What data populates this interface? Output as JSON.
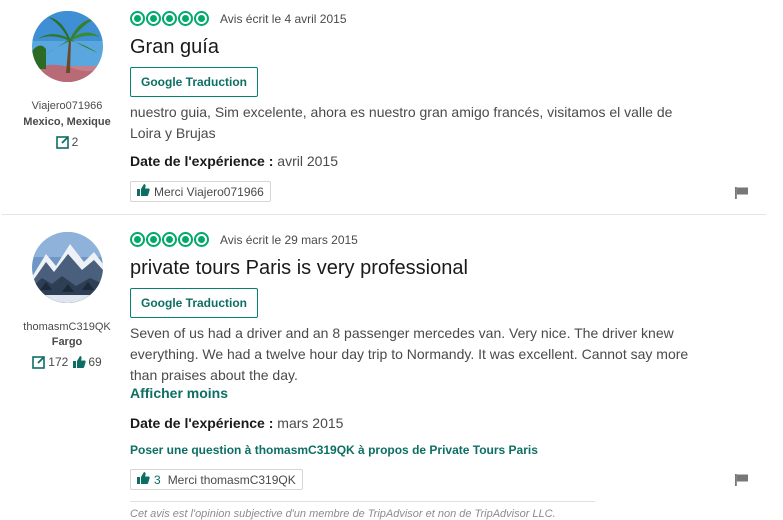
{
  "colors": {
    "accent": "#00aa6c",
    "link": "#0d6f63",
    "text": "#4a4a4a"
  },
  "reviews": [
    {
      "reviewer": {
        "username": "Viajero071966",
        "location": "Mexico, Mexique",
        "review_count": "2"
      },
      "rating": 5,
      "date": "Avis écrit le 4 avril 2015",
      "title": "Gran guía",
      "translate_label": "Google Traduction",
      "text": "nuestro guia, Sim excelente, ahora es nuestro gran amigo francés, visitamos el valle de Loira y Brujas",
      "experience_label": "Date de l'expérience :",
      "experience_value": "avril 2015",
      "thanks_label": "Merci Viajero071966"
    },
    {
      "reviewer": {
        "username": "thomasmC319QK",
        "location": "Fargo",
        "review_count": "172",
        "helpful_count": "69"
      },
      "rating": 5,
      "date": "Avis écrit le 29 mars 2015",
      "title": "private tours Paris is very professional",
      "translate_label": "Google Traduction",
      "text": "Seven of us had a driver and an 8 passenger mercedes van. Very nice. The driver knew everything. We had a twelve hour day trip to Normandy. It was excellent. Cannot say more than praises about the day.",
      "more_label": "Afficher moins",
      "experience_label": "Date de l'expérience :",
      "experience_value": "mars 2015",
      "ask_label": "Poser une question à thomasmC319QK à propos de Private Tours Paris",
      "thanks_count": "3",
      "thanks_label": "Merci thomasmC319QK",
      "disclaimer": "Cet avis est l'opinion subjective d'un membre de TripAdvisor et non de TripAdvisor LLC."
    }
  ]
}
